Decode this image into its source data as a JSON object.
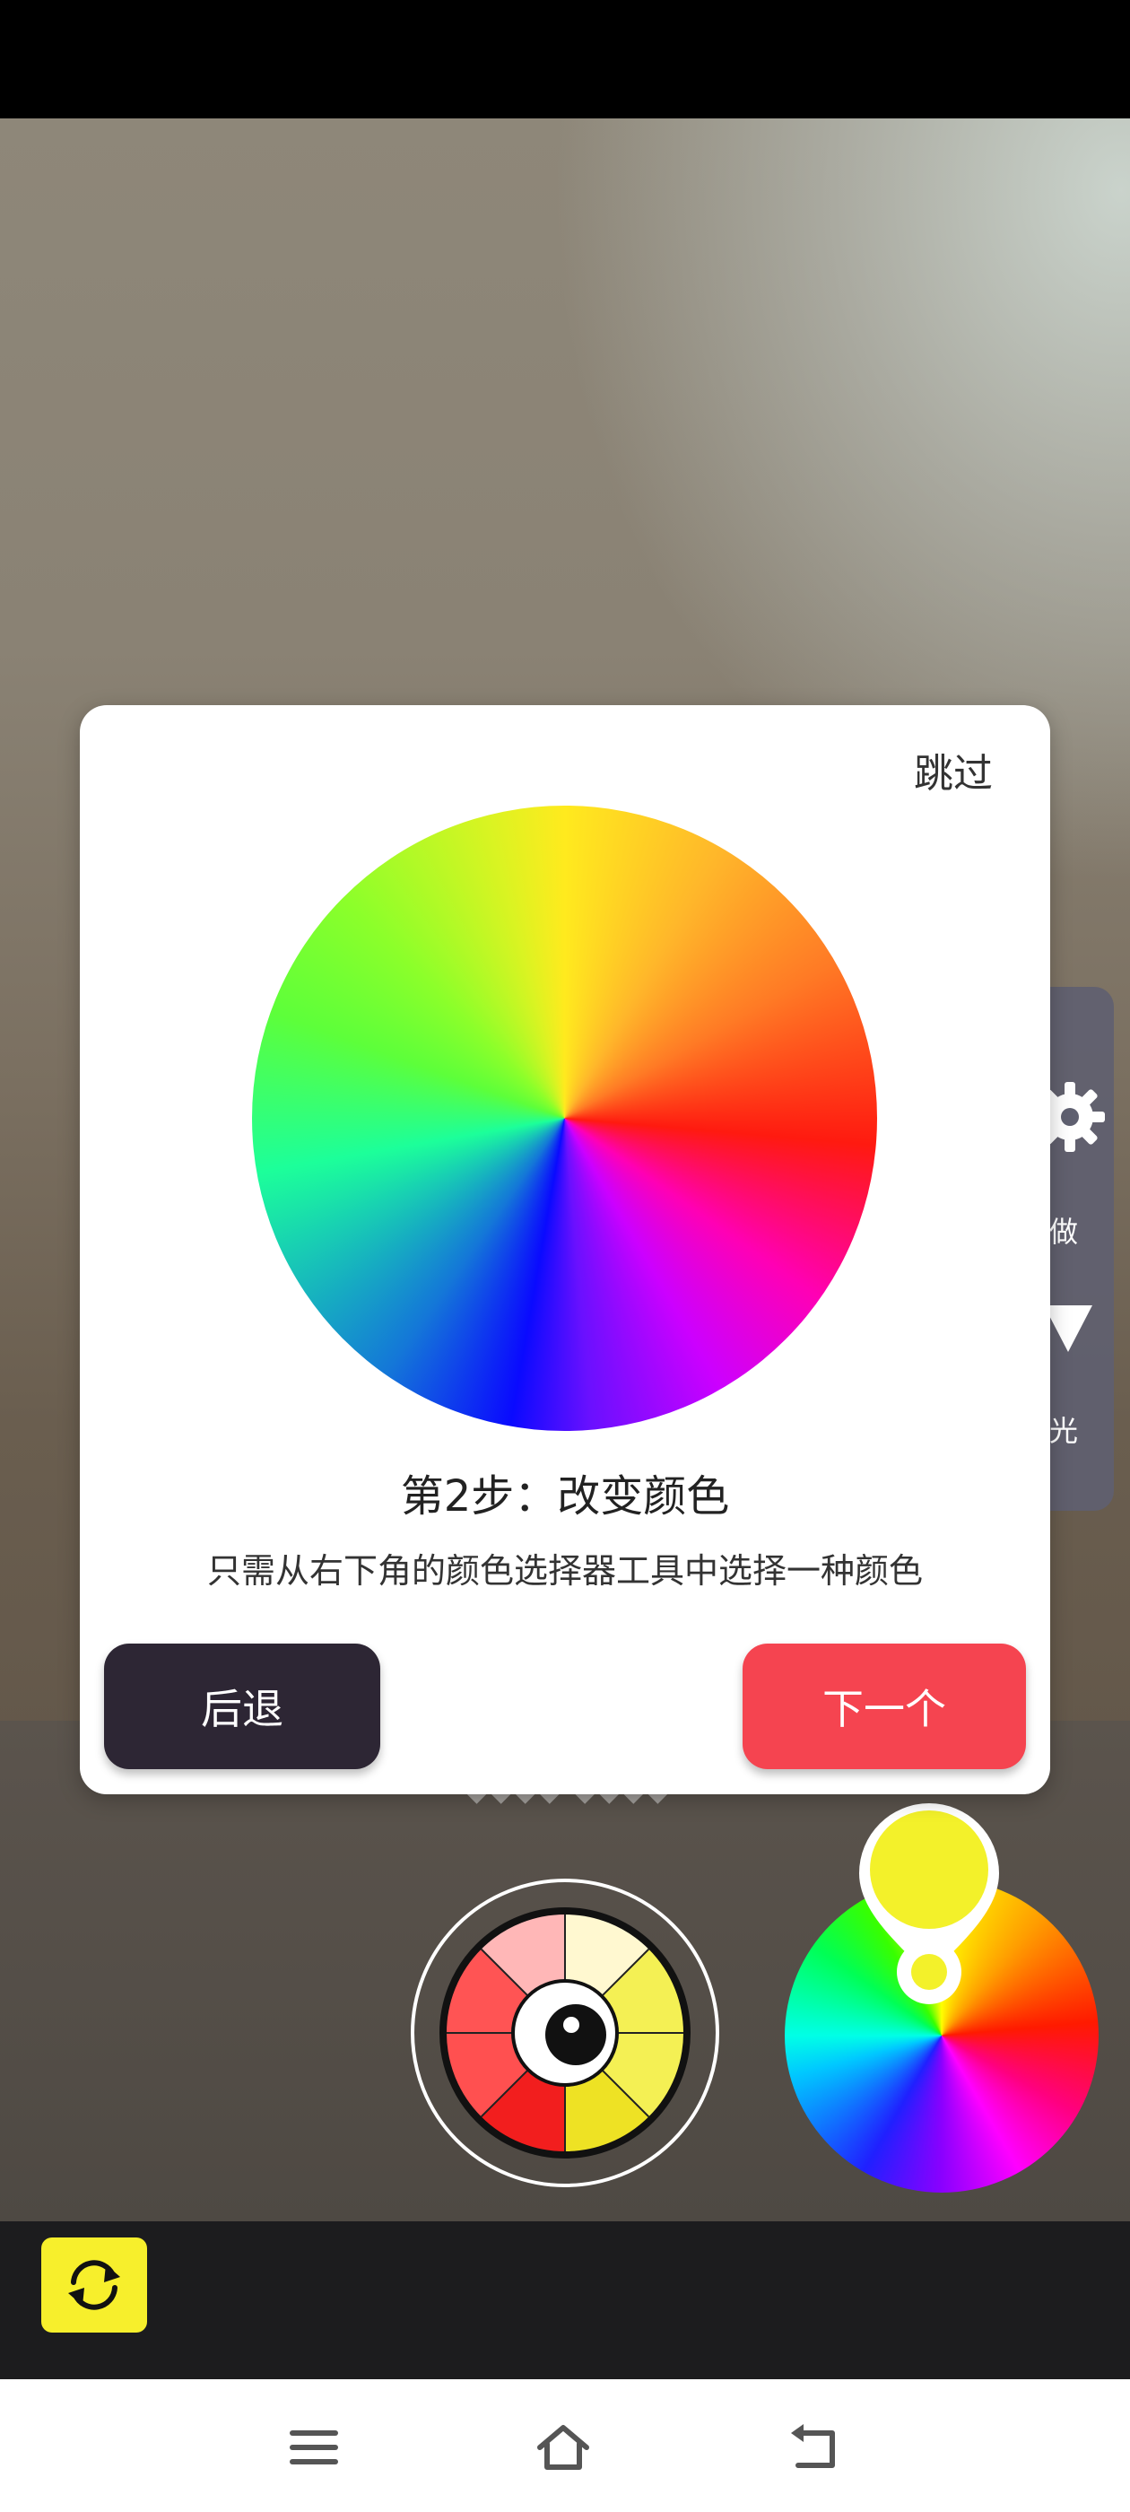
{
  "camera": {
    "overlay_text": "◆◆◆◆ ◆◆◆◆"
  },
  "side_panel": {
    "item1_label": "做",
    "item2_label": "光"
  },
  "tutorial": {
    "skip_label": "跳过",
    "step_title": "第2步：改变颜色",
    "step_description": "只需从右下角的颜色选择器工具中选择一种颜色",
    "back_label": "后退",
    "next_label": "下一个"
  },
  "colors": {
    "next_button": "#f54450",
    "back_button": "#2d2634",
    "selected_color": "#f3f12a",
    "flip_button": "#f7ef2c"
  },
  "icons": {
    "camera_flip": "camera-flip-icon",
    "menu": "menu-icon",
    "home": "home-icon",
    "back": "back-icon"
  }
}
